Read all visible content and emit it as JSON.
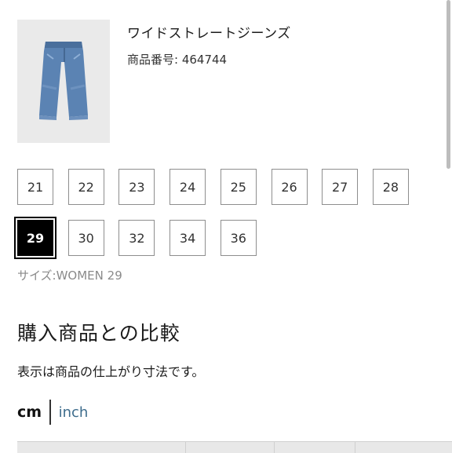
{
  "product": {
    "name": "ワイドストレートジーンズ",
    "number": "商品番号: 464744",
    "image_icon": "jeans-product-image"
  },
  "sizes": [
    "21",
    "22",
    "23",
    "24",
    "25",
    "26",
    "27",
    "28",
    "29",
    "30",
    "32",
    "34",
    "36"
  ],
  "selected_size": "29",
  "size_caption": "サイズ:WOMEN 29",
  "comparison": {
    "heading": "購入商品との比較",
    "note": "表示は商品の仕上がり寸法です。"
  },
  "units": {
    "cm": "cm",
    "inch": "inch",
    "active": "cm"
  },
  "colors": {
    "selected_bg": "#000000",
    "link": "#3d6c8c",
    "border": "#8e8e8e"
  }
}
